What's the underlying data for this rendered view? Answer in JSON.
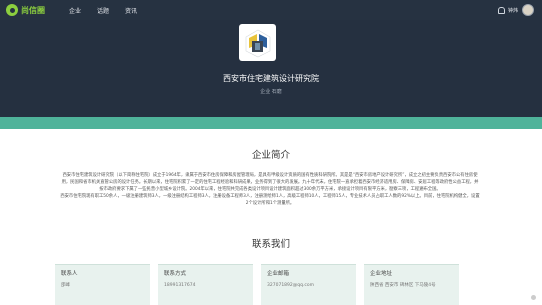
{
  "nav": {
    "logo_text": "尚信圈",
    "items": [
      "企业",
      "话题",
      "资讯"
    ],
    "user_name": "钟炜",
    "colors": {
      "bar": "#263241",
      "logo": "#8ccf3f"
    }
  },
  "hero": {
    "title": "西安市住宅建筑设计研究院",
    "subtitle": "企业   石磨",
    "colors": {
      "background": "#253040",
      "band": "#4fb39a"
    }
  },
  "intro": {
    "heading": "企业简介",
    "paragraph1": "西安市住宅建筑设计研究院（以下简称住宅院）成立于1964年，隶属于西安市住房保障和房屋管理局，是具有甲级设计资质的国有性质科研院所。其是是“西安市房地产设计研究所”，成立之初主要负责西安市公有住房使用，民国和省市机关直管公房的设计任务。长期以来，住宅院积累了一定的住宅工程经验和科研成果，业务得到了很大的发展。九十年代末，住宅院一直承担着西安市经济适用房、保障房、安居工程等政府性公益工程，并按市政府要求下属了一些民营小型城乡设计院。2004年以来，住宅院共完成各类设计项目设计建筑面积超过300余万平方米，承接设计项目有限平方米，勘察三项，工程遍布全国。",
    "paragraph2": "西安市住宅院现有职工50余人，一级注册建筑师3人，一级注册结构工程师3人，注册设备工程师3人，注册测绘师1人，高级工程师10人，工程师15人，专业技术人员占职工人数的92%以上。目前，住宅院机构健全，设置2个设计所和1个测量所。"
  },
  "contact": {
    "heading": "联系我们",
    "cards": [
      {
        "title": "联系人",
        "value": "邵峰"
      },
      {
        "title": "联系方式",
        "value": "18991317674"
      },
      {
        "title": "企业邮箱",
        "value": "327071892@qq.com"
      },
      {
        "title": "企业地址",
        "value": "陕西省 西安市 碑林区 下马陵4号"
      }
    ]
  }
}
